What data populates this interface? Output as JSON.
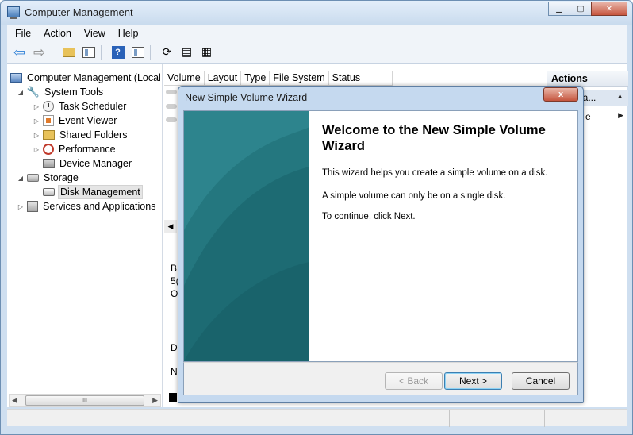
{
  "window": {
    "title": "Computer Management"
  },
  "menu": [
    "File",
    "Action",
    "View",
    "Help"
  ],
  "tree": {
    "root": "Computer Management (Local",
    "items": [
      {
        "label": "System Tools",
        "icon": "tools-icon"
      },
      {
        "label": "Task Scheduler",
        "icon": "clock-icon"
      },
      {
        "label": "Event Viewer",
        "icon": "event-viewer-icon"
      },
      {
        "label": "Shared Folders",
        "icon": "shared-folders-icon"
      },
      {
        "label": "Performance",
        "icon": "performance-icon"
      },
      {
        "label": "Device Manager",
        "icon": "device-manager-icon"
      },
      {
        "label": "Storage",
        "icon": "storage-icon"
      },
      {
        "label": "Disk Management",
        "icon": "disk-icon"
      },
      {
        "label": "Services and Applications",
        "icon": "services-icon"
      }
    ],
    "scroll_thumb": "III"
  },
  "list": {
    "columns": [
      "Volume",
      "Layout",
      "Type",
      "File System",
      "Status"
    ],
    "partial": [
      "B",
      "5(",
      "O",
      "D",
      "N"
    ]
  },
  "actions": {
    "header": "Actions",
    "row1": "na...",
    "row2": "e"
  },
  "wizard": {
    "title": "New Simple Volume Wizard",
    "heading": "Welcome to the New Simple Volume Wizard",
    "p1": "This wizard helps you create a simple volume on a disk.",
    "p2": "A simple volume can only be on a single disk.",
    "p3": "To continue, click Next.",
    "back": "< Back",
    "next": "Next >",
    "cancel": "Cancel",
    "close": "x"
  },
  "colors": {
    "wizard_sidebar": "#1d6b73",
    "frame": "#cfdff0"
  }
}
